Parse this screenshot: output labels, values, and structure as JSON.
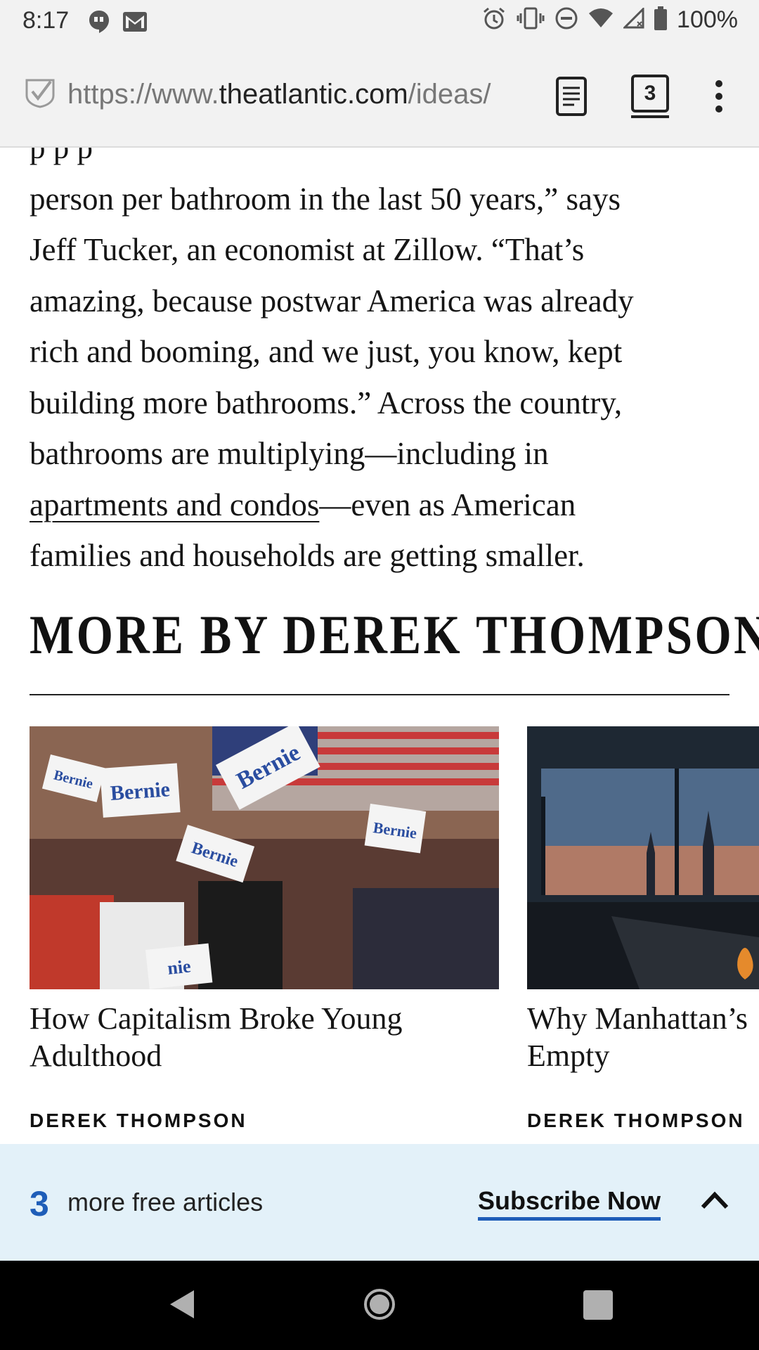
{
  "status_bar": {
    "time": "8:17",
    "battery": "100%"
  },
  "browser": {
    "url_prefix": "https://www.",
    "url_host": "theatlantic.com",
    "url_path": "/ideas/",
    "tab_count": "3"
  },
  "article": {
    "lines_before_link": [
      "person per bathroom in the last 50 years,” says",
      "Jeff Tucker, an economist at Zillow. “That’s",
      "amazing, because postwar America was already",
      "rich and booming, and we just, you know, kept",
      "building more bathrooms.” Across the country,",
      "bathrooms are multiplying—including in"
    ],
    "link_text": "apartments and condos",
    "after_link": "—even as American",
    "last_line": "families and households are getting smaller."
  },
  "more_section": {
    "heading": "MORE BY DEREK THOMPSON",
    "cards": [
      {
        "title_line1": "How Capitalism Broke Young",
        "title_line2": "Adulthood",
        "author": "DEREK THOMPSON",
        "image_signs": [
          "Bernie",
          "Bernie",
          "Bernie",
          "Bernie",
          "Bernie",
          "nie"
        ]
      },
      {
        "title_line1": "Why Manhattan’s",
        "title_line2": "Empty",
        "author": "DEREK THOMPSON"
      }
    ]
  },
  "subscribe_banner": {
    "count": "3",
    "label": "more free articles",
    "cta": "Subscribe Now"
  },
  "colors": {
    "accent_blue": "#1e5db8",
    "banner_bg": "#e3f1f9"
  }
}
